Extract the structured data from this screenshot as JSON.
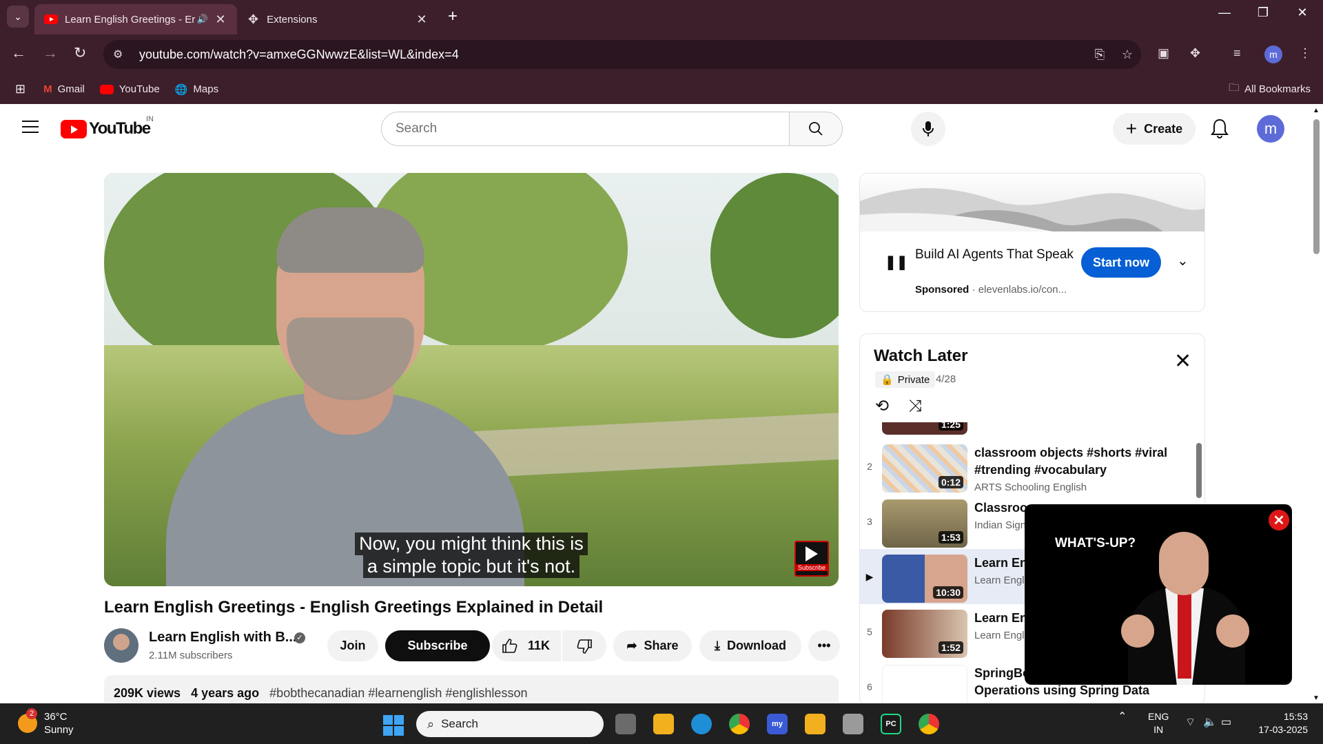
{
  "browser": {
    "tabs": [
      {
        "title": "Learn English Greetings - Er",
        "active": true
      },
      {
        "title": "Extensions",
        "active": false
      }
    ],
    "url": "youtube.com/watch?v=amxeGGNwwzE&list=WL&index=4",
    "bookmarks": [
      "Gmail",
      "YouTube",
      "Maps"
    ],
    "all_bookmarks": "All Bookmarks",
    "profile_initial": "m"
  },
  "header": {
    "logo_text": "YouTube",
    "country_code": "IN",
    "search_placeholder": "Search",
    "create_label": "Create",
    "avatar_initial": "m"
  },
  "video": {
    "caption_line1": "Now, you might think this is",
    "caption_line2": "a simple topic but it's not.",
    "subscribe_badge": "Subscribe",
    "title": "Learn English Greetings - English Greetings Explained in Detail",
    "channel_name": "Learn English with B...",
    "subscribers": "2.11M subscribers",
    "join_label": "Join",
    "subscribe_label": "Subscribe",
    "likes": "11K",
    "share_label": "Share",
    "download_label": "Download",
    "views": "209K views",
    "age": "4 years ago",
    "tags": "#bobthecanadian #learnenglish #englishlesson"
  },
  "ad": {
    "title": "Build AI Agents That Speak",
    "sponsored": "Sponsored",
    "domain": "elevenlabs.io/con...",
    "cta": "Start now"
  },
  "watch_later": {
    "title": "Watch Later",
    "privacy": "Private",
    "position": "4/28",
    "items": [
      {
        "index": "",
        "title": "",
        "channel": "",
        "duration": "1:25",
        "thumb_color": "#5a2f2a"
      },
      {
        "index": "2",
        "title": "classroom objects #shorts #viral #trending #vocabulary",
        "channel": "ARTS Schooling English",
        "duration": "0:12",
        "thumb_color": "#e9e4d9"
      },
      {
        "index": "3",
        "title": "Classroom",
        "channel": "Indian Sign",
        "duration": "1:53",
        "thumb_color": "#8a7c58"
      },
      {
        "index": "▶",
        "title": "Learn Eng English Gr",
        "channel": "Learn Engli",
        "duration": "10:30",
        "thumb_color": "#3a5aa6"
      },
      {
        "index": "5",
        "title": "Learn Eng Unit 3 Gre",
        "channel": "Learn Engli",
        "duration": "1:52",
        "thumb_color": "#7a3a2a"
      },
      {
        "index": "6",
        "title": "SpringBoot REST API CRUD Operations using Spring Data",
        "channel": "",
        "duration": "",
        "thumb_color": "#ffffff"
      }
    ]
  },
  "popup": {
    "text": "WHAT'S-UP?"
  },
  "taskbar": {
    "weather_badge": "2",
    "temperature": "36°C",
    "condition": "Sunny",
    "search_label": "Search",
    "lang": "ENG",
    "region": "IN",
    "time": "15:53",
    "date": "17-03-2025"
  }
}
